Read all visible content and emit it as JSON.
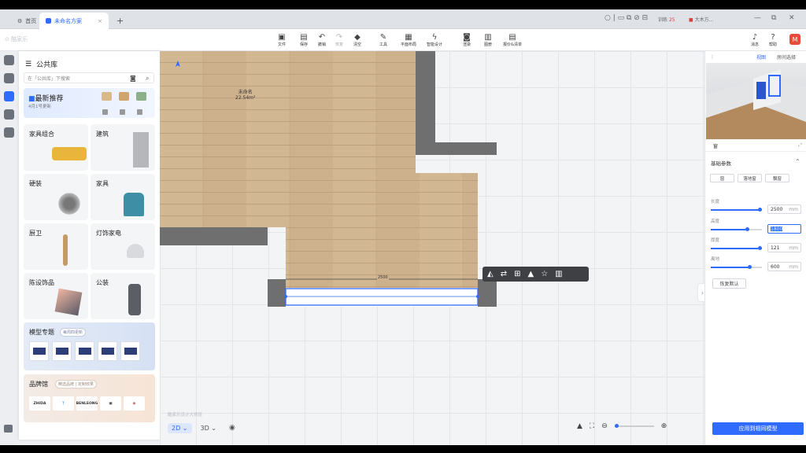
{
  "tabs": {
    "home": "首页",
    "project": "未命名方案",
    "new": "+"
  },
  "titlebar": {
    "badge_label": "训练",
    "badge_count": "25",
    "user": "大木方..."
  },
  "toolbar": {
    "items": [
      "文件",
      "保存",
      "撤销",
      "恢复",
      "清空",
      "工具",
      "平面布局",
      "智能设计",
      "渲染",
      "图册",
      "报价&清单"
    ]
  },
  "library": {
    "title": "公共库",
    "search_placeholder": "在「公共库」下搜索",
    "new_title": "最新推荐",
    "new_sub": "4月1号更新",
    "categories": [
      "家具组合",
      "建筑",
      "硬装",
      "家具",
      "厨卫",
      "灯饰家电",
      "陈设饰品",
      "公装"
    ],
    "topics_title": "模型专题",
    "topics_pill": "每周四更新",
    "brand_title": "品牌馆",
    "brand_pill": "精选品牌 | 定制效果",
    "brands": [
      "ZHIDA",
      "",
      "BENLEONG",
      "",
      ""
    ]
  },
  "canvas": {
    "room_name": "未命名",
    "room_area": "22.54m²",
    "dim_label": "2500",
    "watermark": "酷家乐设计大师班"
  },
  "floating_toolbar": {
    "icons": [
      "mirror-icon",
      "swap-icon",
      "copy-icon",
      "lock-icon",
      "star-icon",
      "trash-icon"
    ]
  },
  "viewbar": {
    "mode2d": "2D",
    "mode3d": "3D"
  },
  "right_panel": {
    "tabs": [
      "视图",
      "房间选择"
    ],
    "section": "窗",
    "basics": "基础参数",
    "segments": [
      "窗",
      "落地窗",
      "飘窗"
    ],
    "props": [
      {
        "label": "长度",
        "value": "2500",
        "unit": "mm",
        "fill": 0.95
      },
      {
        "label": "高度",
        "value": "1800",
        "unit": "",
        "fill": 0.7
      },
      {
        "label": "厚度",
        "value": "121",
        "unit": "mm",
        "fill": 0.95
      },
      {
        "label": "离地",
        "value": "600",
        "unit": "mm",
        "fill": 0.75
      }
    ],
    "restore": "恢复默认",
    "apply": "应用到相同模型"
  }
}
